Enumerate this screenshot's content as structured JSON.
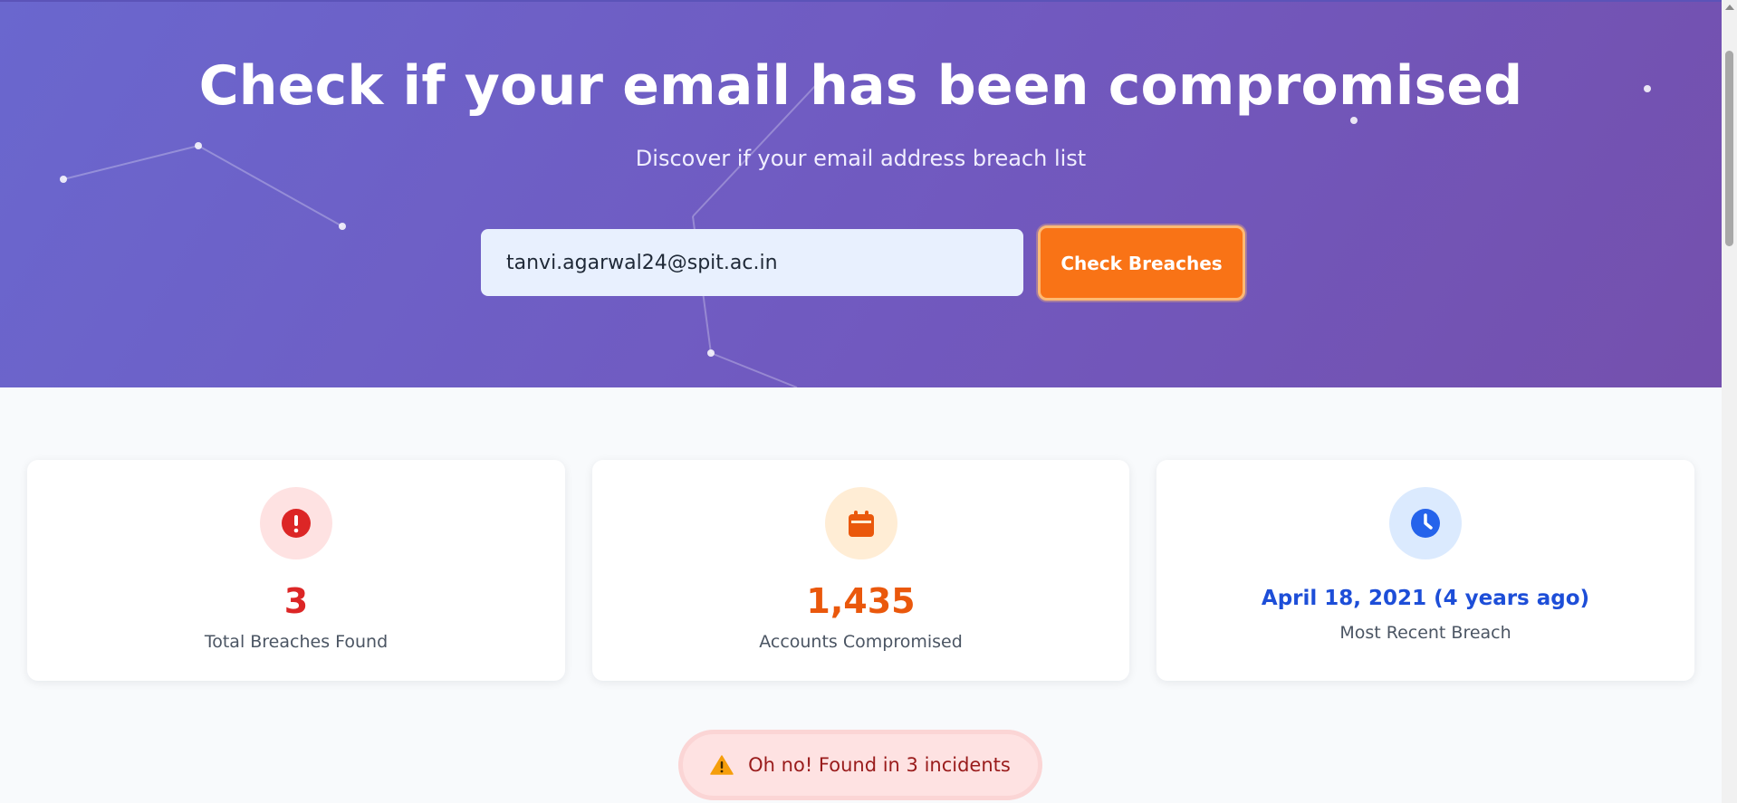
{
  "hero": {
    "title": "Check if your email has been compromised",
    "subtitle": "Discover if your email address breach list",
    "email_value": "tanvi.agarwal24@spit.ac.in",
    "check_button_label": "Check Breaches"
  },
  "stats": [
    {
      "icon": "exclamation-circle-icon",
      "value": "3",
      "label": "Total Breaches Found",
      "color": "#dc2626"
    },
    {
      "icon": "calendar-icon",
      "value": "1,435",
      "label": "Accounts Compromised",
      "color": "#ea580c"
    },
    {
      "icon": "clock-icon",
      "value": "April 18, 2021 (4 years ago)",
      "label": "Most Recent Breach",
      "color": "#1d4ed8"
    }
  ],
  "alert": {
    "icon": "warning-icon",
    "text": "Oh no! Found in 3 incidents"
  },
  "colors": {
    "hero_gradient_start": "#6a67ce",
    "hero_gradient_end": "#7450ad",
    "accent_orange": "#f97316",
    "danger_red": "#dc2626",
    "info_blue": "#1d4ed8"
  }
}
